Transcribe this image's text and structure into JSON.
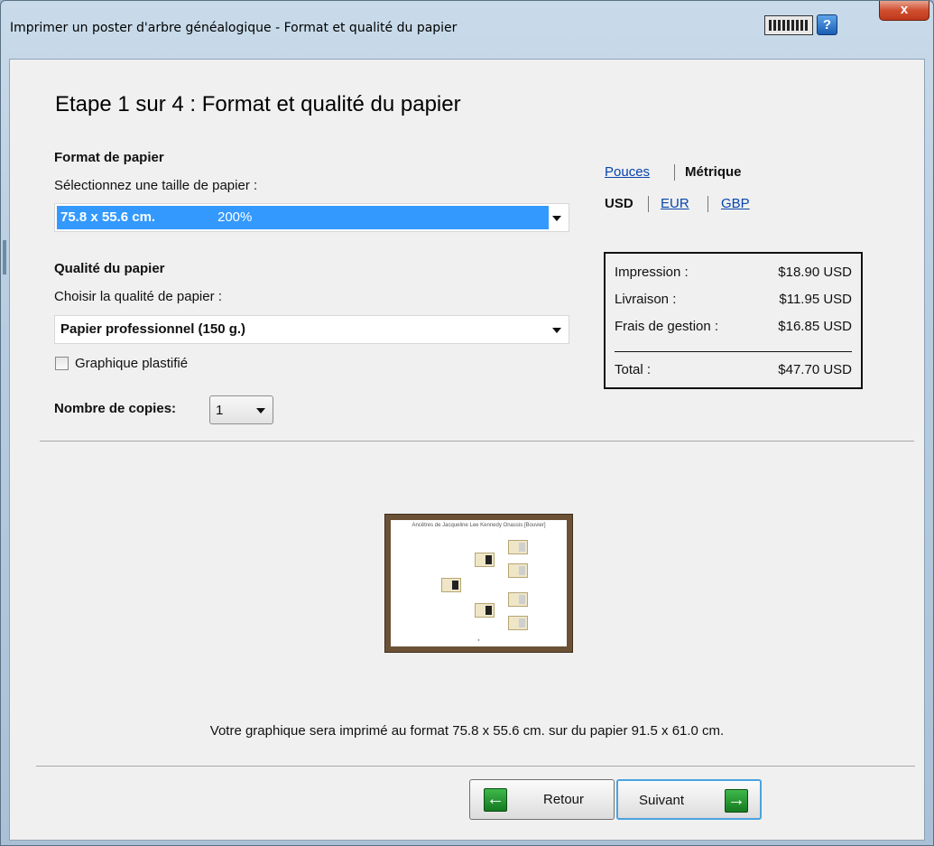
{
  "window": {
    "title": "Imprimer un poster d'arbre généalogique - Format et qualité du papier",
    "help_glyph": "?",
    "close_glyph": "x"
  },
  "step_title": "Etape 1 sur 4 : Format et qualité du papier",
  "paper_format": {
    "heading": "Format de papier",
    "prompt": "Sélectionnez une taille de papier :",
    "selected_size": "75.8 x 55.6 cm.",
    "selected_scale": "200%"
  },
  "paper_quality": {
    "heading": "Qualité du papier",
    "prompt": "Choisir la qualité de papier :",
    "selected": "Papier professionnel (150 g.)",
    "laminated_label": "Graphique plastifié",
    "laminated_checked": false
  },
  "copies": {
    "label": "Nombre de copies:",
    "value": "1"
  },
  "units": {
    "inches": "Pouces",
    "metric": "Métrique",
    "selected": "metric"
  },
  "currency": {
    "usd": "USD",
    "eur": "EUR",
    "gbp": "GBP",
    "selected": "usd"
  },
  "prices": {
    "printing_label": "Impression :",
    "printing_value": "$18.90 USD",
    "shipping_label": "Livraison :",
    "shipping_value": "$11.95 USD",
    "handling_label": "Frais de gestion :",
    "handling_value": "$16.85 USD",
    "total_label": "Total :",
    "total_value": "$47.70 USD"
  },
  "preview": {
    "poster_title": "Ancêtres de Jacqueline Lee Kennedy Onassis [Bouvier]"
  },
  "summary": "Votre graphique sera imprimé au format 75.8 x 55.6 cm. sur du papier 91.5 x 61.0 cm.",
  "buttons": {
    "back": "Retour",
    "next": "Suivant"
  }
}
